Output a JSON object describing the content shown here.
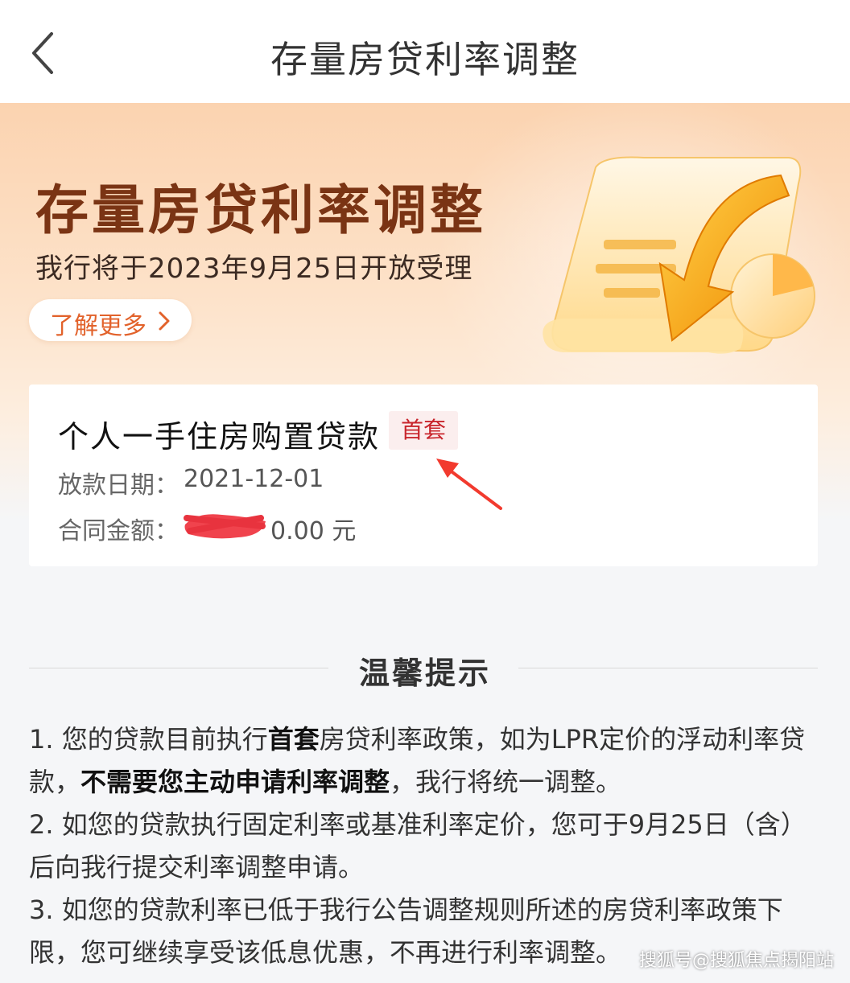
{
  "nav": {
    "title": "存量房贷利率调整"
  },
  "banner": {
    "title": "存量房贷利率调整",
    "subtitle": "我行将于2023年9月25日开放受理",
    "learn_more": "了解更多"
  },
  "loan": {
    "name": "个人一手住房购置贷款",
    "badge": "首套",
    "date_label": "放款日期：",
    "date_value": "2021-12-01",
    "amount_label": "合同金额：",
    "amount_value": "0.00 元"
  },
  "tips": {
    "title": "温馨提示",
    "item1": {
      "p1": "1. 您的贷款目前执行",
      "b1": "首套",
      "p2": "房贷利率政策，如为LPR定价的浮动利率贷款，",
      "b2": "不需要您主动申请利率调整",
      "p3": "，我行将统一调整。"
    },
    "item2": "2. 如您的贷款执行固定利率或基准利率定价，您可于9月25日（含）后向我行提交利率调整申请。",
    "item3": "3. 如您的贷款利率已低于我行公告调整规则所述的房贷利率政策下限，您可继续享受该低息优惠，不再进行利率调整。"
  },
  "watermark": "搜狐号@搜狐焦点揭阳站",
  "colors": {
    "accent_orange": "#e2622b",
    "badge_red": "#c8252c",
    "banner_title": "#7a3414"
  }
}
